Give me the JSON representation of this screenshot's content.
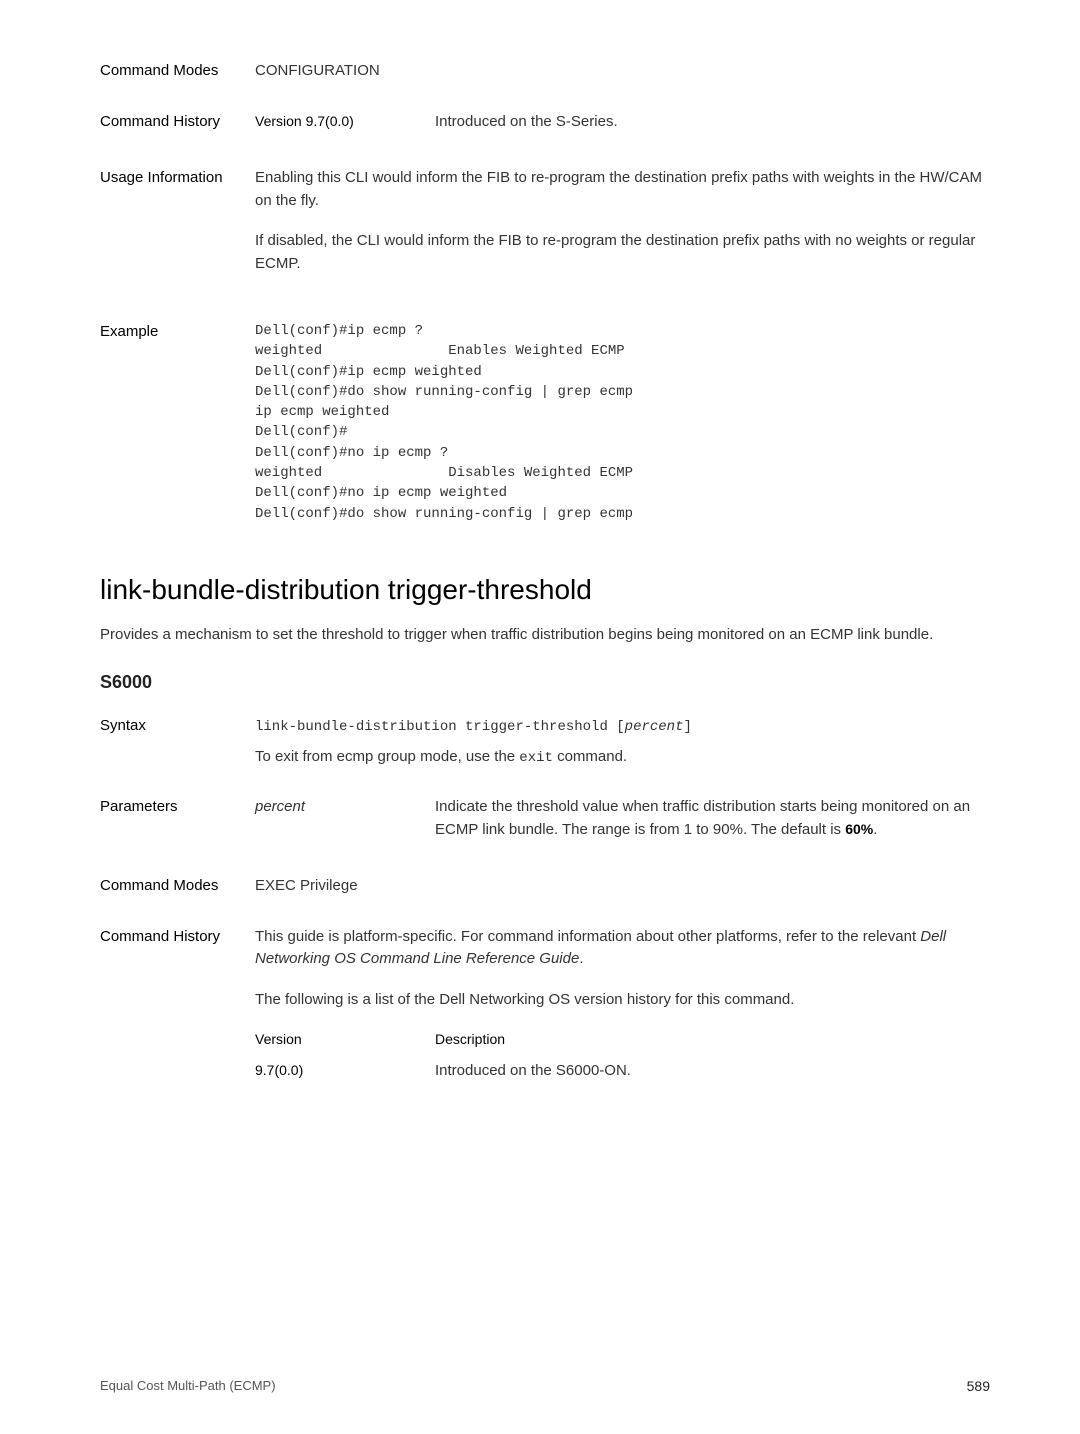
{
  "top": {
    "command_modes": {
      "label": "Command Modes",
      "content": "CONFIGURATION"
    },
    "command_history": {
      "label": "Command History",
      "version_label": "Version 9.7(0.0)",
      "version_desc": "Introduced on the S-Series."
    },
    "usage_info": {
      "label": "Usage Information",
      "para1": "Enabling this CLI would inform the FIB to re-program the destination prefix paths with weights in the HW/CAM on the fly.",
      "para2": "If disabled, the CLI would inform the FIB to re-program the destination prefix paths with no weights or regular ECMP."
    },
    "example": {
      "label": "Example",
      "code": "Dell(conf)#ip ecmp ?\nweighted               Enables Weighted ECMP\nDell(conf)#ip ecmp weighted\nDell(conf)#do show running-config | grep ecmp\nip ecmp weighted\nDell(conf)#\nDell(conf)#no ip ecmp ?\nweighted               Disables Weighted ECMP\nDell(conf)#no ip ecmp weighted\nDell(conf)#do show running-config | grep ecmp"
    }
  },
  "bottom": {
    "heading": "link-bundle-distribution trigger-threshold",
    "intro": "Provides a mechanism to set the threshold to trigger when traffic distribution begins being monitored on an ECMP link bundle.",
    "model": "S6000",
    "syntax": {
      "label": "Syntax",
      "code_prefix": "link-bundle-distribution trigger-threshold [",
      "code_param": "percent",
      "code_suffix": "]",
      "note_prefix": "To exit from ecmp group mode, use the ",
      "note_code": "exit",
      "note_suffix": " command."
    },
    "parameters": {
      "label": "Parameters",
      "item_label": "percent",
      "desc_prefix": "Indicate the threshold value when traffic distribution starts being monitored on an ECMP link bundle. The range is from 1 to 90%. The default is ",
      "desc_bold": "60%",
      "desc_suffix": "."
    },
    "command_modes": {
      "label": "Command Modes",
      "content": "EXEC Privilege"
    },
    "command_history": {
      "label": "Command History",
      "para1_prefix": "This guide is platform-specific. For command information about other platforms, refer to the relevant ",
      "para1_italic": "Dell Networking OS Command Line Reference Guide",
      "para1_suffix": ".",
      "para2": "The following is a list of the Dell Networking OS version history for this command.",
      "table_h1": "Version",
      "table_h2": "Description",
      "table_r1c1": "9.7(0.0)",
      "table_r1c2": "Introduced on the S6000-ON."
    }
  },
  "footer": {
    "left": "Equal Cost Multi-Path (ECMP)",
    "page": "589"
  }
}
